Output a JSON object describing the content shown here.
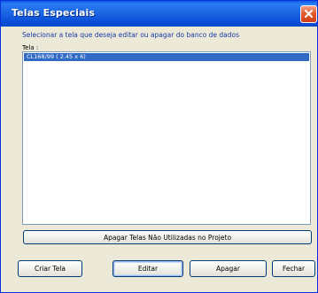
{
  "window": {
    "title": "Telas Especiais"
  },
  "dialog": {
    "instruction": "Selecionar a tela que deseja editar ou apagar do banco de dados",
    "list_label": "Tela :",
    "items": [
      {
        "label": "CL168/99 ( 2.45 x 6)",
        "selected": true
      }
    ]
  },
  "buttons": {
    "delete_unused": "Apagar Telas Não Utilizadas no Projeto",
    "create": "Criar Tela",
    "edit": "Editar",
    "delete": "Apagar",
    "close": "Fechar"
  },
  "colors": {
    "titlebar": "#0b4fd8",
    "selection": "#316ac5",
    "close_button": "#e45c2f"
  }
}
